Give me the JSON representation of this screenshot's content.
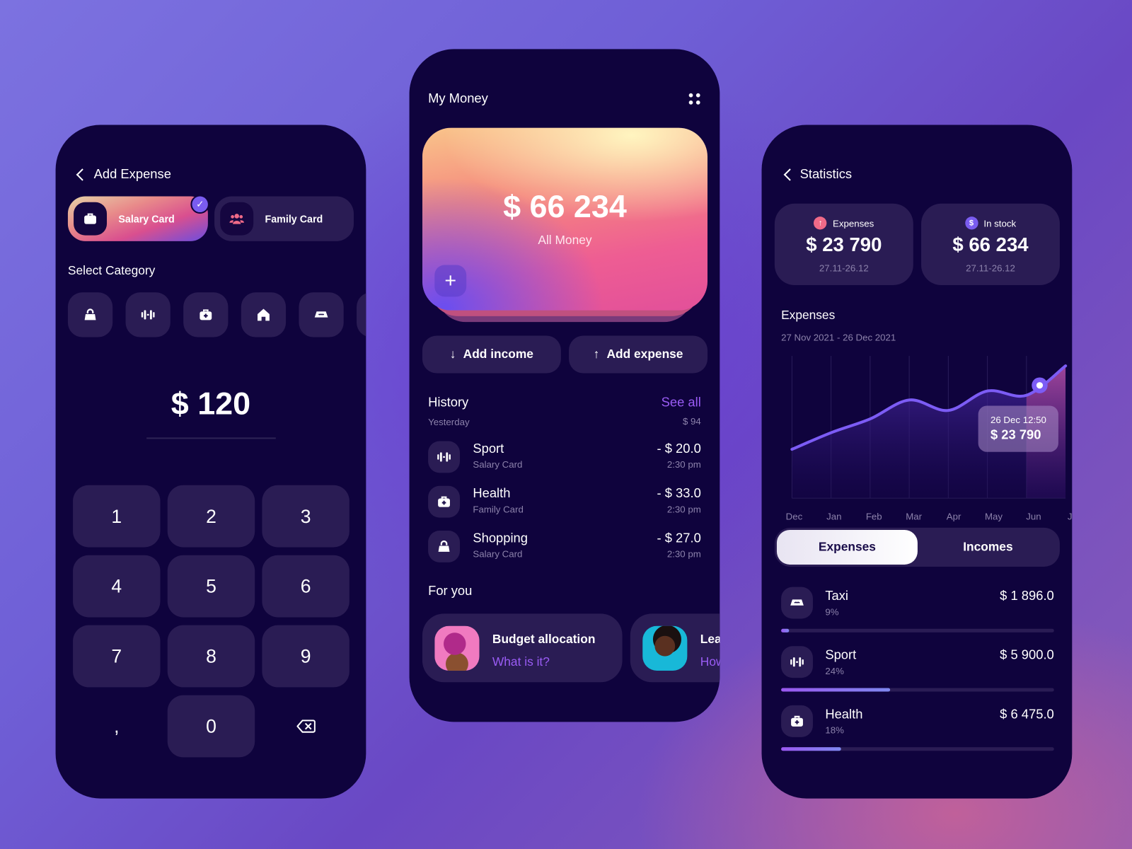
{
  "colors": {
    "background": "#0f033d",
    "tile": "#2a1c54",
    "accent": "#9a5cf5",
    "line": "#7c5cf5"
  },
  "add_expense": {
    "title": "Add Expense",
    "cards": [
      {
        "label": "Salary Card",
        "icon": "briefcase-icon",
        "selected": true
      },
      {
        "label": "Family Card",
        "icon": "people-icon",
        "selected": false
      }
    ],
    "category_heading": "Select Category",
    "categories": [
      {
        "icon": "shopping-bag-icon"
      },
      {
        "icon": "dumbbell-icon"
      },
      {
        "icon": "medkit-icon"
      },
      {
        "icon": "home-icon"
      },
      {
        "icon": "taxi-icon"
      }
    ],
    "amount": "$ 120",
    "keys": [
      "1",
      "2",
      "3",
      "4",
      "5",
      "6",
      "7",
      "8",
      "9",
      ",",
      "0",
      "backspace"
    ]
  },
  "my_money": {
    "title": "My Money",
    "balance": "$ 66 234",
    "balance_label": "All Money",
    "add_income": "Add income",
    "add_expense": "Add expense",
    "history_title": "History",
    "see_all": "See all",
    "day": "Yesterday",
    "day_total": "$ 94",
    "history": [
      {
        "title": "Sport",
        "card": "Salary Card",
        "amount": "- $ 20.0",
        "time": "2:30 pm",
        "icon": "dumbbell-icon"
      },
      {
        "title": "Health",
        "card": "Family Card",
        "amount": "- $ 33.0",
        "time": "2:30 pm",
        "icon": "medkit-icon"
      },
      {
        "title": "Shopping",
        "card": "Salary Card",
        "amount": "- $ 27.0",
        "time": "2:30 pm",
        "icon": "shopping-bag-icon"
      }
    ],
    "for_you_title": "For you",
    "for_you": [
      {
        "title": "Budget allocation",
        "link": "What is it?"
      },
      {
        "title": "Lea",
        "link": "How"
      }
    ]
  },
  "statistics": {
    "title": "Statistics",
    "stat_cards": [
      {
        "label": "Expenses",
        "value": "$ 23 790",
        "range": "27.11-26.12",
        "icon": "arrow-up-icon"
      },
      {
        "label": "In stock",
        "value": "$ 66 234",
        "range": "27.11-26.12",
        "icon": "dollar-icon"
      }
    ],
    "chart_title": "Expenses",
    "chart_range": "27 Nov 2021 - 26 Dec 2021",
    "tabs": [
      {
        "label": "Expenses",
        "active": true
      },
      {
        "label": "Incomes",
        "active": false
      }
    ],
    "breakdown": [
      {
        "title": "Taxi",
        "percent": "9%",
        "amount": "$ 1 896.0",
        "icon": "taxi-icon",
        "fill": 0.02
      },
      {
        "title": "Sport",
        "percent": "24%",
        "amount": "$ 5 900.0",
        "icon": "dumbbell-icon",
        "fill": 0.4
      },
      {
        "title": "Health",
        "percent": "18%",
        "amount": "$ 6 475.0",
        "icon": "medkit-icon",
        "fill": 0.22
      }
    ]
  },
  "chart_data": {
    "type": "area",
    "categories": [
      "Dec",
      "Jan",
      "Feb",
      "Mar",
      "Apr",
      "May",
      "Jun",
      "Jul"
    ],
    "values": [
      10300,
      13800,
      16700,
      20700,
      18500,
      22600,
      21700,
      27900
    ],
    "highlight": {
      "label": "26 Dec 12:50",
      "value_text": "$ 23 790",
      "value": 23790,
      "between": [
        "Jun",
        "Jul"
      ]
    },
    "ylim": [
      0,
      30000
    ],
    "grid": "vertical"
  }
}
